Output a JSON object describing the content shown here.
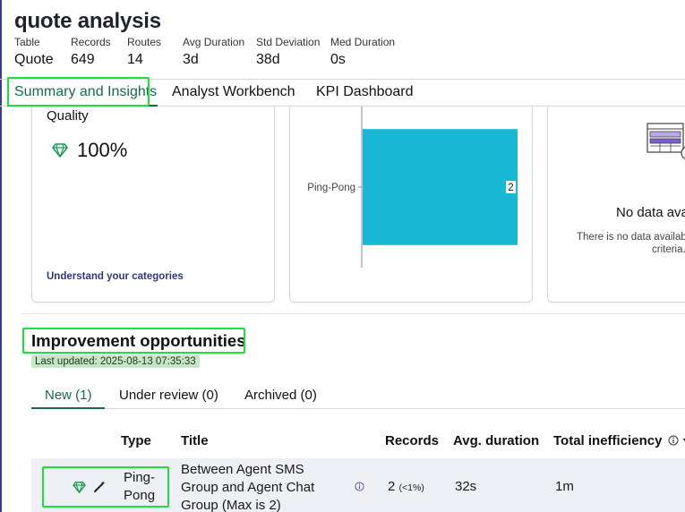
{
  "header": {
    "title": "quote analysis",
    "stats": [
      {
        "label": "Table",
        "value": "Quote"
      },
      {
        "label": "Records",
        "value": "649"
      },
      {
        "label": "Routes",
        "value": "14"
      },
      {
        "label": "Avg Duration",
        "value": "3d"
      },
      {
        "label": "Std Deviation",
        "value": "38d"
      },
      {
        "label": "Med Duration",
        "value": "0s"
      }
    ]
  },
  "tabs": [
    {
      "label": "Summary and Insights",
      "active": true
    },
    {
      "label": "Analyst Workbench",
      "active": false
    },
    {
      "label": "KPI Dashboard",
      "active": false
    }
  ],
  "quality_card": {
    "label": "Quality",
    "value": "100%",
    "link": "Understand your categories",
    "icon": "gem-icon"
  },
  "chart_data": {
    "type": "bar",
    "orientation": "horizontal",
    "categories": [
      "Ping-Pong"
    ],
    "values": [
      2
    ],
    "data_labels": [
      "2"
    ],
    "bar_color": "#17b8d6"
  },
  "no_data_card": {
    "title": "No data ava",
    "text_line1": "There is no data availabl",
    "text_line2": "criteria."
  },
  "improvement": {
    "title": "Improvement opportunities",
    "last_updated": "Last updated: 2025-08-13 07:35:33",
    "subtabs": [
      {
        "label": "New (1)",
        "active": true
      },
      {
        "label": "Under review (0)",
        "active": false
      },
      {
        "label": "Archived (0)",
        "active": false
      }
    ],
    "columns": {
      "type": "Type",
      "title": "Title",
      "records": "Records",
      "avg_duration": "Avg. duration",
      "total_inefficiency": "Total inefficiency"
    },
    "rows": [
      {
        "type": "Ping-Pong",
        "title": "Between Agent SMS Group and Agent Chat Group (Max is 2)",
        "records": "2",
        "records_pct": "(<1%)",
        "avg_duration": "32s",
        "total_inefficiency": "1m"
      }
    ]
  },
  "colors": {
    "accent_green": "#176b48",
    "highlight": "#19e23a",
    "gem": "#1f9a55",
    "bar": "#17b8d6"
  }
}
